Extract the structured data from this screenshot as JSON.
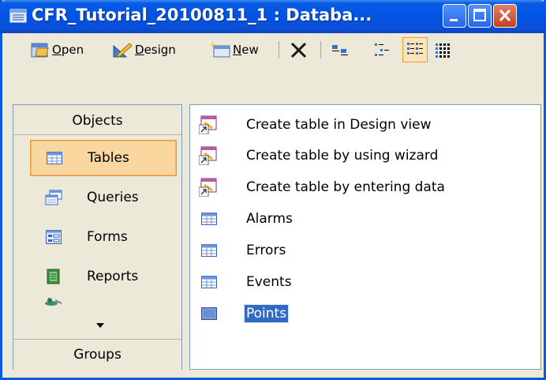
{
  "window": {
    "title": "CFR_Tutorial_20100811_1 : Databa..."
  },
  "toolbar": {
    "open_label": "Open",
    "open_key": "O",
    "design_label": "Design",
    "design_key": "D",
    "new_label": "New",
    "new_key": "N"
  },
  "objects_header": "Objects",
  "objects": [
    {
      "label": "Tables",
      "icon": "table-icon",
      "selected": true
    },
    {
      "label": "Queries",
      "icon": "query-icon"
    },
    {
      "label": "Forms",
      "icon": "form-icon"
    },
    {
      "label": "Reports",
      "icon": "report-icon"
    },
    {
      "label": "",
      "icon": "page-icon"
    }
  ],
  "groups_header": "Groups",
  "items": [
    {
      "label": "Create table in Design view",
      "icon": "shortcut-icon"
    },
    {
      "label": "Create table by using wizard",
      "icon": "shortcut-icon"
    },
    {
      "label": "Create table by entering data",
      "icon": "shortcut-icon"
    },
    {
      "label": "Alarms",
      "icon": "table-icon"
    },
    {
      "label": "Errors",
      "icon": "table-icon"
    },
    {
      "label": "Events",
      "icon": "table-icon"
    },
    {
      "label": "Points",
      "icon": "linked-table-icon",
      "selected": true
    }
  ],
  "colors": {
    "titlebar": "#0055e5",
    "selection_blue": "#316ac5",
    "selected_object": "#fbd7a0"
  }
}
